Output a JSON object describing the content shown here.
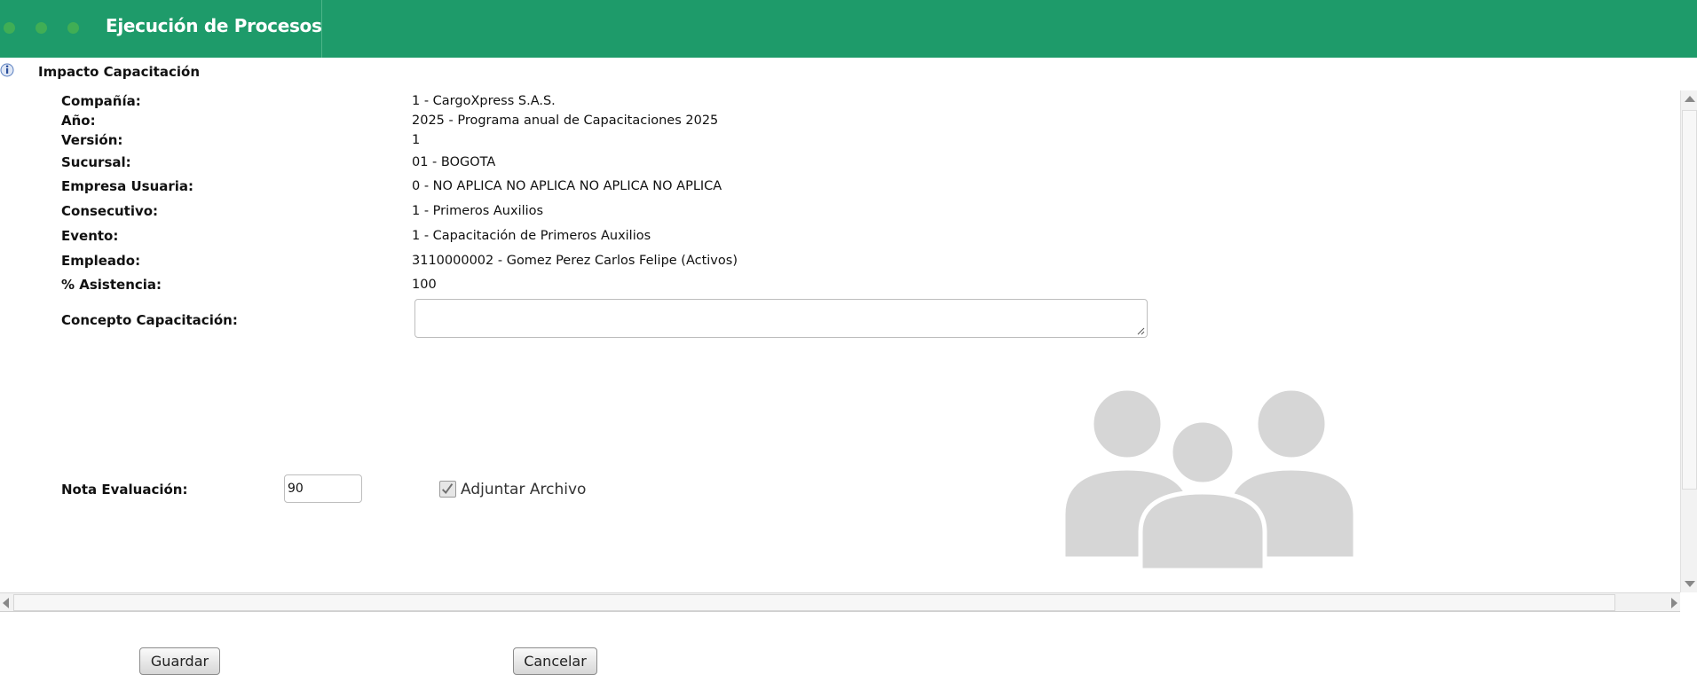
{
  "window": {
    "title": "Ejecución de Procesos"
  },
  "section": {
    "title": "Impacto Capacitación"
  },
  "fields": [
    {
      "label": "Compañía:",
      "value": "1 - CargoXpress S.A.S."
    },
    {
      "label": "Año:",
      "value": "2025 - Programa anual de Capacitaciones 2025"
    },
    {
      "label": "Versión:",
      "value": "1"
    },
    {
      "label": "Sucursal:",
      "value": "01 - BOGOTA"
    },
    {
      "label": "Empresa Usuaria:",
      "value": "0 - NO APLICA NO APLICA NO APLICA NO APLICA"
    },
    {
      "label": "Consecutivo:",
      "value": "1 - Primeros Auxilios"
    },
    {
      "label": "Evento:",
      "value": "1 - Capacitación de Primeros Auxilios"
    },
    {
      "label": "Empleado:",
      "value": "3110000002 - Gomez Perez Carlos Felipe (Activos)"
    },
    {
      "label": "% Asistencia:",
      "value": "100"
    }
  ],
  "concepto": {
    "label": "Concepto Capacitación:",
    "value": ""
  },
  "nota": {
    "label": "Nota Evaluación:",
    "value": "90"
  },
  "adjuntar": {
    "label": "Adjuntar Archivo",
    "checked": true
  },
  "buttons": {
    "save": "Guardar",
    "cancel": "Cancelar"
  },
  "colors": {
    "header_green": "#1e9b6a",
    "placeholder_gray": "#d6d6d6"
  },
  "icons": {
    "section": "info-icon",
    "illustration": "people-group-icon"
  }
}
